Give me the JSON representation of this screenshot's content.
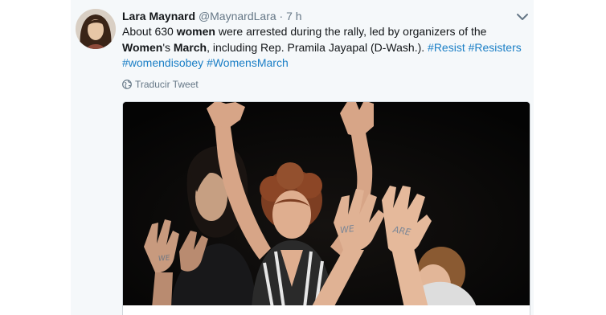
{
  "tweet": {
    "display_name": "Lara Maynard",
    "handle": "@MaynardLara",
    "separator": "·",
    "time": "7 h",
    "body": {
      "part1": "About 630 ",
      "bold1": "women",
      "part2": " were arrested during the rally, led by organizers of the ",
      "bold2": "Women",
      "part3": "'s ",
      "bold3": "March",
      "part4": ", including Rep. Pramila Jayapal (D-Wash.). ",
      "hashtags": [
        "#Resist",
        "#Resisters",
        "#womendisobey",
        "#WomensMarch"
      ]
    },
    "translate_label": "Traducir Tweet",
    "media": {
      "hand_writing": [
        "WE",
        "WE",
        "ARE"
      ]
    }
  },
  "colors": {
    "link": "#1b7fc6",
    "text": "#14171a",
    "secondary": "#657786",
    "background": "#f5f8fa",
    "photo": "#060606"
  },
  "icons": [
    "chevron-down-icon",
    "globe-icon"
  ]
}
